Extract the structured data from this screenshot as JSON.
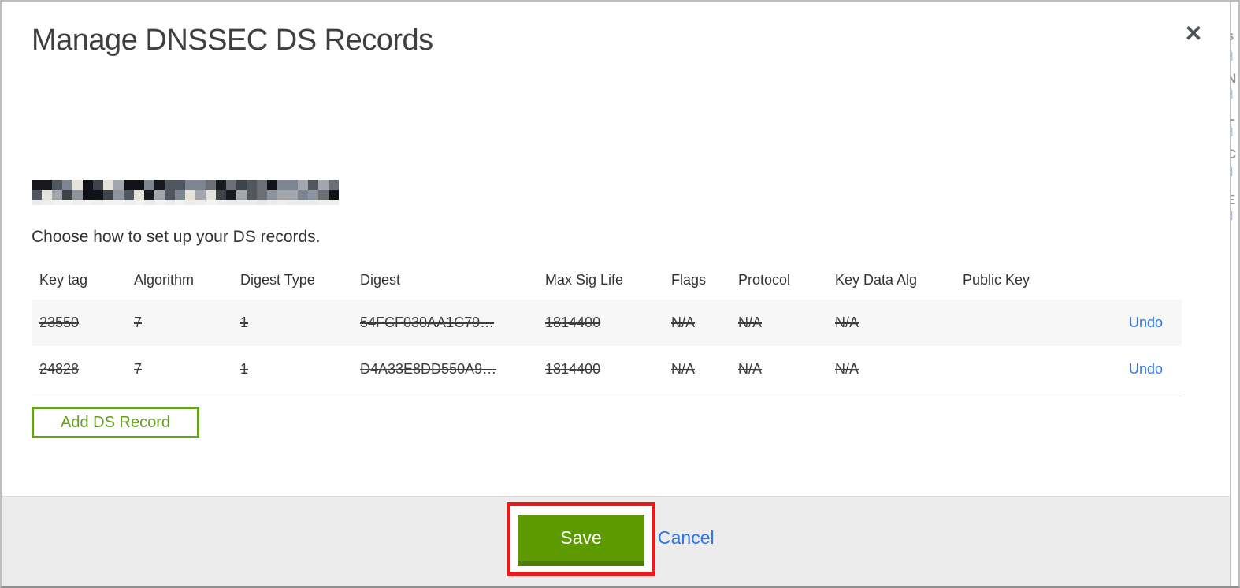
{
  "modal": {
    "title": "Manage DNSSEC DS Records",
    "close_glyph": "✕",
    "subtitle": "Choose how to set up your DS records.",
    "table": {
      "columns": [
        "Key tag",
        "Algorithm",
        "Digest Type",
        "Digest",
        "Max Sig Life",
        "Flags",
        "Protocol",
        "Key Data Alg",
        "Public Key"
      ],
      "rows": [
        {
          "cells": [
            "23550",
            "7",
            "1",
            "54FCF030AA1C79…",
            "1814400",
            "N/A",
            "N/A",
            "N/A",
            ""
          ],
          "action": "Undo",
          "deleted": true
        },
        {
          "cells": [
            "24828",
            "7",
            "1",
            "D4A33E8DD550A9…",
            "1814400",
            "N/A",
            "N/A",
            "N/A",
            ""
          ],
          "action": "Undo",
          "deleted": true
        }
      ]
    },
    "add_button_label": "Add DS Record",
    "footer": {
      "save_label": "Save",
      "cancel_label": "Cancel"
    }
  },
  "colors": {
    "accent_green": "#5d9a00",
    "accent_green_dark": "#4c7d05",
    "outline_green": "#669f1f",
    "link_blue": "#2e78f0",
    "annotation_red": "#ea1a1a",
    "footer_gray": "#ececec",
    "row_shade": "#f7f7f8"
  },
  "background_page": {
    "fragments": [
      "s",
      "d",
      "N",
      "d",
      "L",
      "d",
      "C",
      "d",
      "E",
      "d"
    ]
  }
}
